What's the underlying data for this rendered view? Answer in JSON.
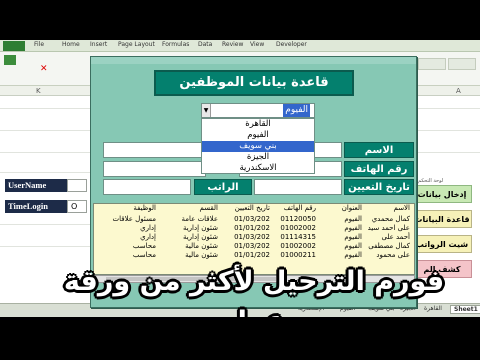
{
  "ribbon": {
    "tabs": [
      "File",
      "Home",
      "Insert",
      "Page Layout",
      "Formulas",
      "Data",
      "Review",
      "View",
      "Developer"
    ]
  },
  "sheet": {
    "column_k": "K",
    "column_a": "A",
    "left_labels": {
      "username": "UserName",
      "timelogin": "TimeLogin",
      "value_partial": "O"
    },
    "side_buttons": [
      "إدخال بيانات",
      "قاعدة البيانات",
      "شيت الرواتب",
      "كشف الم"
    ],
    "side_small_label": "لوحة التحكم",
    "tabs": [
      "Sheet1",
      "القاهرة",
      "الجيزة",
      "بني سويف",
      "الفيوم",
      "الإسكندرية"
    ]
  },
  "form": {
    "title": "قاعدة بيانات الموظفين",
    "labels": {
      "name": "الاسم",
      "phone": "رقم الهاتف",
      "hire_date": "تاريخ التعيين",
      "salary": "الراتب"
    },
    "combo": {
      "value": "الفيوم"
    },
    "dropdown": [
      "القاهرة",
      "الفيوم",
      "بني سويف",
      "الجيزة",
      "الاسكندرية"
    ],
    "dropdown_selected": 2,
    "listbox": {
      "headers": {
        "name": "الاسم",
        "address": "العنوان",
        "phone": "رقم الهاتف",
        "date": "تاريخ التعيين",
        "dept": "القسم",
        "job": "الوظيفة"
      },
      "rows": [
        {
          "name": "كمال محمدي",
          "address": "الفيوم",
          "phone": "01120050",
          "date": "01/03/202",
          "dept": "علاقات عامة",
          "job": "مسئول علاقات"
        },
        {
          "name": "على احمد سيد",
          "address": "الفيوم",
          "phone": "01002002",
          "date": "01/01/202",
          "dept": "شئون إدارية",
          "job": "إداري"
        },
        {
          "name": "أحمد على",
          "address": "الفيوم",
          "phone": "01114315",
          "date": "01/03/202",
          "dept": "شئون إدارية",
          "job": "إداري"
        },
        {
          "name": "كمال مصطفى",
          "address": "الفيوم",
          "phone": "01002002",
          "date": "01/03/202",
          "dept": "شئون مالية",
          "job": "محاسب"
        },
        {
          "name": "على محمود",
          "address": "الفيوم",
          "phone": "01000211",
          "date": "01/01/202",
          "dept": "شئون مالية",
          "job": "محاسب"
        }
      ]
    }
  },
  "overlay_title": "فورم الترحيل لأكثر من ورقة عمل"
}
